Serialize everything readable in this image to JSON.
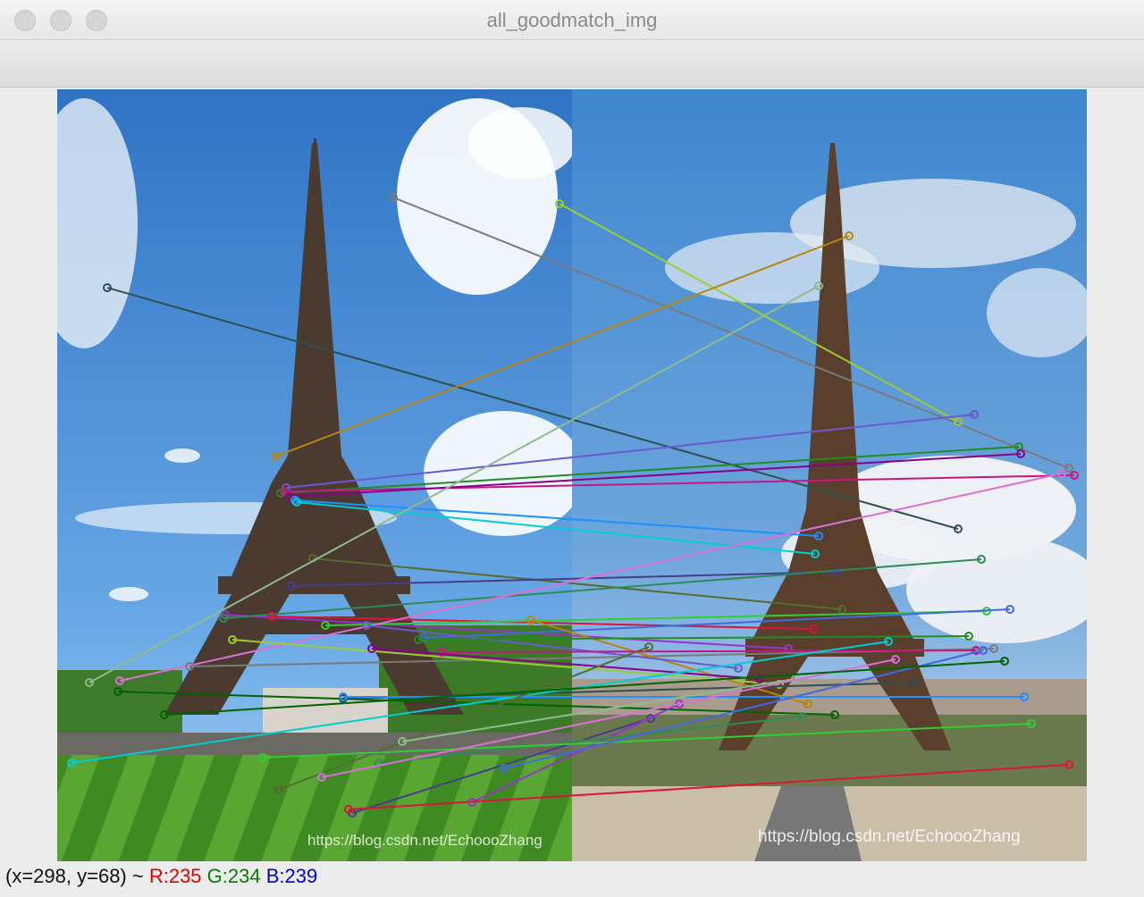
{
  "window": {
    "title": "all_goodmatch_img"
  },
  "canvas": {
    "left_image": {
      "sky_color": "#3f86d4",
      "grass_color": "#4e9a2c"
    },
    "right_image": {
      "sky_color": "#4d8fd6",
      "city_color": "#b5aaa0"
    },
    "watermark_left": "https://blog.csdn.net/EchoooZhang",
    "watermark_right": "https://blog.csdn.net/EchoooZhang",
    "match_colors": [
      "#7a7a7a",
      "#9acd32",
      "#2f4f4f",
      "#b8860b",
      "#6a5acd",
      "#228b22",
      "#c71585",
      "#8b008b",
      "#1e90ff",
      "#00ced1",
      "#556b2f",
      "#483d8b",
      "#9932cc",
      "#2e8b57",
      "#dc143c",
      "#32cd32",
      "#4169e1",
      "#8fbc8f",
      "#da70d6",
      "#006400"
    ]
  },
  "status": {
    "coords": "(x=298, y=68) ~ ",
    "r": "R:235",
    "g": "G:234",
    "b": "B:239"
  }
}
